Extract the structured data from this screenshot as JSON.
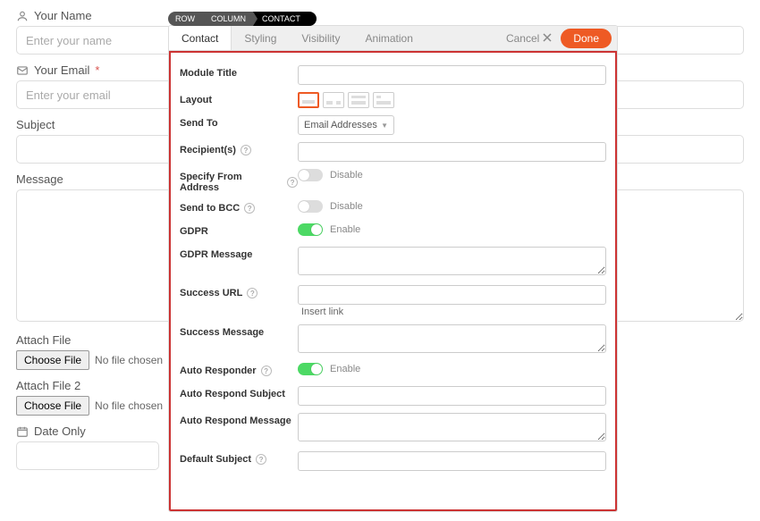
{
  "bg": {
    "name_label": "Your Name",
    "name_placeholder": "Enter your name",
    "email_label": "Your Email",
    "email_required": "*",
    "email_placeholder": "Enter your email",
    "subject_label": "Subject",
    "message_label": "Message",
    "attach1_label": "Attach File",
    "attach2_label": "Attach File 2",
    "choose_file": "Choose File",
    "no_file": "No file chosen",
    "date_label": "Date Only"
  },
  "crumb": {
    "row": "ROW",
    "column": "COLUMN",
    "contact": "CONTACT"
  },
  "tabs": {
    "contact": "Contact",
    "styling": "Styling",
    "visibility": "Visibility",
    "animation": "Animation"
  },
  "actions": {
    "cancel": "Cancel",
    "done": "Done"
  },
  "panel": {
    "module_title": "Module Title",
    "layout": "Layout",
    "send_to": "Send To",
    "send_to_value": "Email Addresses",
    "recipients": "Recipient(s)",
    "specify_from": "Specify From Address",
    "send_bcc": "Send to BCC",
    "gdpr": "GDPR",
    "gdpr_message": "GDPR Message",
    "success_url": "Success URL",
    "insert_link": "Insert link",
    "success_message": "Success Message",
    "auto_responder": "Auto Responder",
    "auto_subject": "Auto Respond Subject",
    "auto_message": "Auto Respond Message",
    "default_subject": "Default Subject",
    "disable": "Disable",
    "enable": "Enable"
  }
}
